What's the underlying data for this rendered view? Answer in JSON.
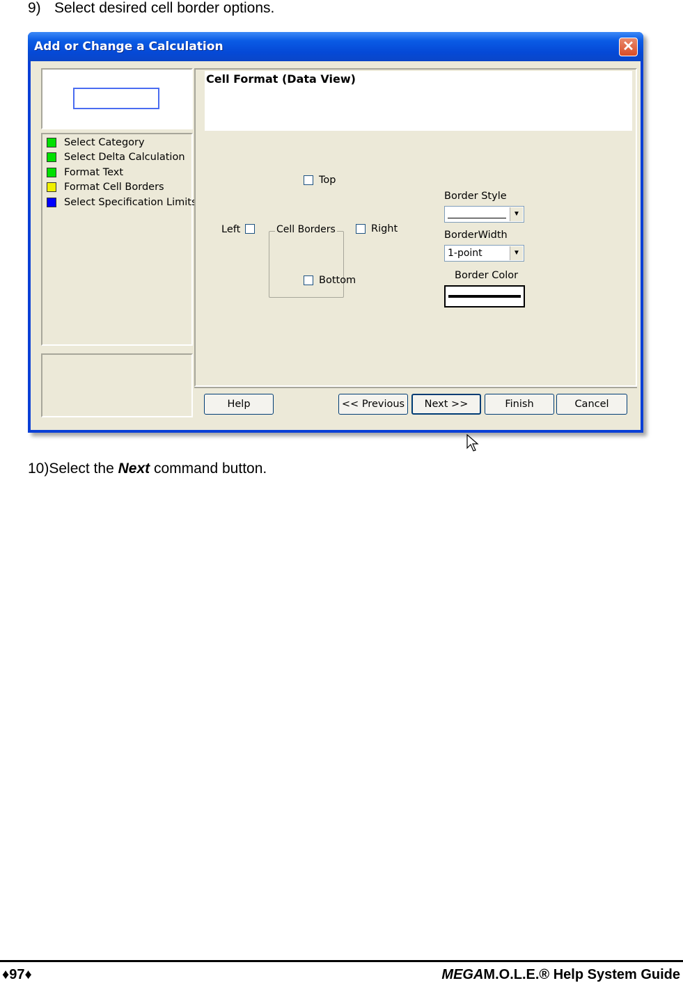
{
  "step9": {
    "number": "9)",
    "text": "Select desired cell border options."
  },
  "step10": {
    "number": "10)",
    "prefix": "Select the ",
    "emphasis": "Next",
    "suffix": " command button."
  },
  "dialog": {
    "title": "Add or Change a Calculation",
    "close_glyph": "✕",
    "steps": [
      {
        "label": "Select Category",
        "color": "#00e000"
      },
      {
        "label": "Select Delta Calculation",
        "color": "#00e000"
      },
      {
        "label": "Format Text",
        "color": "#00e000"
      },
      {
        "label": "Format Cell Borders",
        "color": "#f0f000"
      },
      {
        "label": "Select Specification Limits",
        "color": "#0000ff"
      }
    ],
    "header_title": "Cell Format (Data View)",
    "checkboxes": {
      "top": "Top",
      "left": "Left",
      "right": "Right",
      "bottom": "Bottom"
    },
    "group_caption": "Cell Borders",
    "border_style_label": "Border Style",
    "border_width_label": "BorderWidth",
    "border_width_value": "1-point",
    "border_color_label": "Border Color",
    "combo_arrow": "▼",
    "buttons": {
      "help": "Help",
      "previous": "<< Previous",
      "next": "Next >>",
      "finish": "Finish",
      "cancel": "Cancel"
    }
  },
  "footer": {
    "left": "♦97♦",
    "right_em": "MEGA",
    "right_rest": "M.O.L.E.® Help System Guide"
  }
}
